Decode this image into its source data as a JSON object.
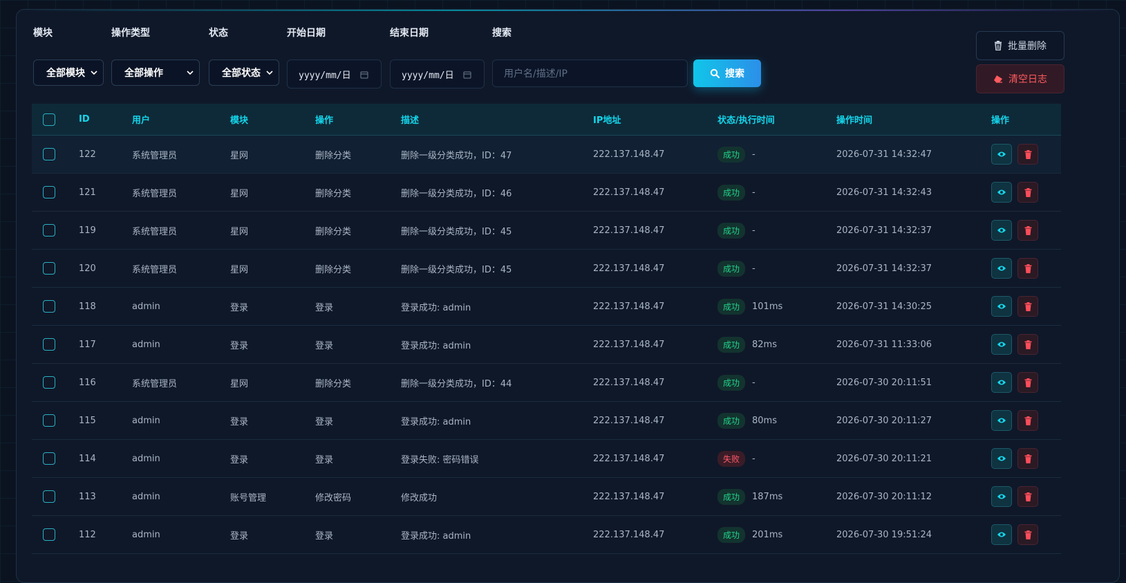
{
  "filters": {
    "module": {
      "label": "模块",
      "value": "全部模块"
    },
    "op_type": {
      "label": "操作类型",
      "value": "全部操作"
    },
    "status": {
      "label": "状态",
      "value": "全部状态"
    },
    "start_date": {
      "label": "开始日期",
      "value": "yyyy/mm/日"
    },
    "end_date": {
      "label": "结束日期",
      "value": "yyyy/mm/日"
    },
    "search": {
      "label": "搜索",
      "placeholder": "用户名/描述/IP",
      "button": "搜索"
    }
  },
  "actions": {
    "batch_delete": "批量删除",
    "clear_logs": "清空日志"
  },
  "table": {
    "headers": {
      "id": "ID",
      "user": "用户",
      "module": "模块",
      "op": "操作",
      "desc": "描述",
      "ip": "IP地址",
      "status": "状态/执行时间",
      "time": "操作时间",
      "actions": "操作"
    },
    "rows": [
      {
        "id": "122",
        "user": "系统管理员",
        "module": "星网",
        "op": "删除分类",
        "desc": "删除一级分类成功，ID：47",
        "ip": "222.137.148.47",
        "status": "成功",
        "duration": "-",
        "time": "2026-07-31 14:32:47"
      },
      {
        "id": "121",
        "user": "系统管理员",
        "module": "星网",
        "op": "删除分类",
        "desc": "删除一级分类成功，ID：46",
        "ip": "222.137.148.47",
        "status": "成功",
        "duration": "-",
        "time": "2026-07-31 14:32:43"
      },
      {
        "id": "119",
        "user": "系统管理员",
        "module": "星网",
        "op": "删除分类",
        "desc": "删除一级分类成功，ID：45",
        "ip": "222.137.148.47",
        "status": "成功",
        "duration": "-",
        "time": "2026-07-31 14:32:37"
      },
      {
        "id": "120",
        "user": "系统管理员",
        "module": "星网",
        "op": "删除分类",
        "desc": "删除一级分类成功，ID：45",
        "ip": "222.137.148.47",
        "status": "成功",
        "duration": "-",
        "time": "2026-07-31 14:32:37"
      },
      {
        "id": "118",
        "user": "admin",
        "module": "登录",
        "op": "登录",
        "desc": "登录成功: admin",
        "ip": "222.137.148.47",
        "status": "成功",
        "duration": "101ms",
        "time": "2026-07-31 14:30:25"
      },
      {
        "id": "117",
        "user": "admin",
        "module": "登录",
        "op": "登录",
        "desc": "登录成功: admin",
        "ip": "222.137.148.47",
        "status": "成功",
        "duration": "82ms",
        "time": "2026-07-31 11:33:06"
      },
      {
        "id": "116",
        "user": "系统管理员",
        "module": "星网",
        "op": "删除分类",
        "desc": "删除一级分类成功，ID：44",
        "ip": "222.137.148.47",
        "status": "成功",
        "duration": "-",
        "time": "2026-07-30 20:11:51"
      },
      {
        "id": "115",
        "user": "admin",
        "module": "登录",
        "op": "登录",
        "desc": "登录成功: admin",
        "ip": "222.137.148.47",
        "status": "成功",
        "duration": "80ms",
        "time": "2026-07-30 20:11:27"
      },
      {
        "id": "114",
        "user": "admin",
        "module": "登录",
        "op": "登录",
        "desc": "登录失败: 密码错误",
        "ip": "222.137.148.47",
        "status": "失败",
        "duration": "-",
        "time": "2026-07-30 20:11:21"
      },
      {
        "id": "113",
        "user": "admin",
        "module": "账号管理",
        "op": "修改密码",
        "desc": "修改成功",
        "ip": "222.137.148.47",
        "status": "成功",
        "duration": "187ms",
        "time": "2026-07-30 20:11:12"
      },
      {
        "id": "112",
        "user": "admin",
        "module": "登录",
        "op": "登录",
        "desc": "登录成功: admin",
        "ip": "222.137.148.47",
        "status": "成功",
        "duration": "201ms",
        "time": "2026-07-30 19:51:24"
      }
    ]
  },
  "colors": {
    "accent": "#14d6ec",
    "success": "#23d28a",
    "danger": "#ff5a5f"
  }
}
